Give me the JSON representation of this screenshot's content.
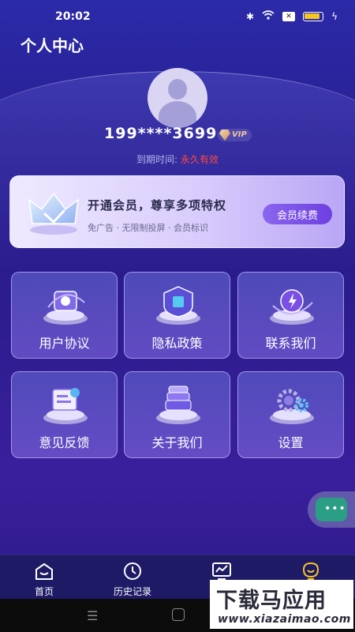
{
  "status_bar": {
    "time": "20:02"
  },
  "header": {
    "title": "个人中心"
  },
  "profile": {
    "phone": "199****3699",
    "vip_badge": "VIP",
    "expiry_label": "到期时间:",
    "expiry_value": "永久有效"
  },
  "vip_card": {
    "title": "开通会员，尊享多项特权",
    "subtitle": "免广告 · 无限制投屏 · 会员标识",
    "renew_label": "会员续费"
  },
  "menu": [
    {
      "label": "用户协议",
      "icon": "document-icon"
    },
    {
      "label": "隐私政策",
      "icon": "shield-icon"
    },
    {
      "label": "联系我们",
      "icon": "phone-icon"
    },
    {
      "label": "意见反馈",
      "icon": "feedback-icon"
    },
    {
      "label": "关于我们",
      "icon": "info-icon"
    },
    {
      "label": "设置",
      "icon": "gear-icon"
    }
  ],
  "float_button": {
    "text": "•••"
  },
  "tabbar": [
    {
      "label": "首页",
      "icon": "home-icon"
    },
    {
      "label": "历史记录",
      "icon": "clock-icon"
    },
    {
      "label": "",
      "icon": "chart-icon"
    },
    {
      "label": "",
      "icon": "profile-icon"
    }
  ],
  "watermark": {
    "title": "下载马应用",
    "url": "www.xiazaimao.com"
  },
  "colors": {
    "accent": "#6d3fe0",
    "expiry": "#ff4a3d",
    "background": "#2a1c8c"
  }
}
